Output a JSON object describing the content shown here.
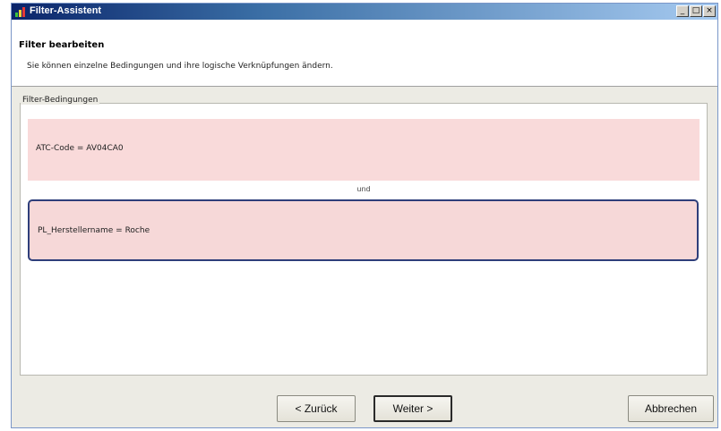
{
  "window": {
    "title": "Filter-Assistent",
    "controls": {
      "minimize": "_",
      "maximize": "□",
      "close": "×"
    }
  },
  "header": {
    "title": "Filter bearbeiten",
    "description": "Sie können einzelne Bedingungen und ihre logische Verknüpfungen ändern."
  },
  "conditions_group": {
    "legend": "Filter-Bedingungen",
    "conditions": [
      {
        "text": "ATC-Code  =  AV04CA0"
      },
      {
        "text": "PL_Herstellername  =  Roche"
      }
    ],
    "operator": "und"
  },
  "buttons": {
    "back": "< Zurück",
    "next": "Weiter >",
    "cancel": "Abbrechen"
  },
  "colors": {
    "condition_bg": "#f9dada",
    "selected_border": "#2e3e7a",
    "titlebar_start": "#0a246a"
  },
  "icons": {
    "app": "chart-icon"
  }
}
